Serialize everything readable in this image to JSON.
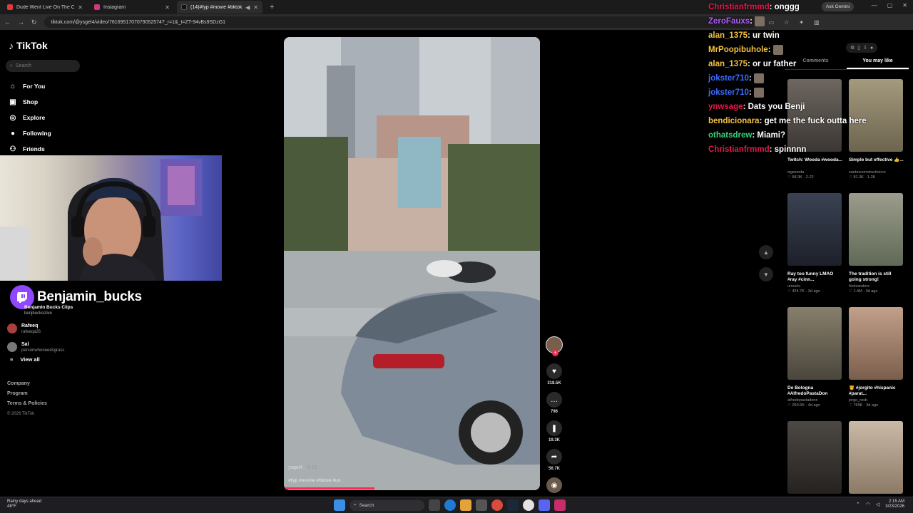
{
  "browser": {
    "tabs": [
      {
        "label": "Dude Went Live On The Opps",
        "color": "#e03a3a"
      },
      {
        "label": "Instagram",
        "color": "#d4377c"
      },
      {
        "label": "(14)#fyp #movie #tiktok #",
        "color": "#222222"
      }
    ],
    "new_tab": "+",
    "url": "tiktok.com/@ysgel4/video/7616951707079052574?_r=1&_t=ZT-94vBs9SDzG1",
    "ask_gemini": "Ask Gemini"
  },
  "sidebar": {
    "logo": "TikTok",
    "search_placeholder": "Search",
    "nav": [
      {
        "label": "For You",
        "icon": "home-icon"
      },
      {
        "label": "Shop",
        "icon": "shop-icon"
      },
      {
        "label": "Explore",
        "icon": "compass-icon"
      },
      {
        "label": "Following",
        "icon": "user-icon"
      },
      {
        "label": "Friends",
        "icon": "friends-icon"
      }
    ],
    "accounts": [
      {
        "name": "Rafeeq",
        "handle": "rafeeqa26"
      },
      {
        "name": "Sal",
        "handle": "personwhoneedsgrass"
      }
    ],
    "view_all": "View all",
    "footer": [
      "Company",
      "Program",
      "Terms & Policies"
    ],
    "copyright": "© 2026 TikTok"
  },
  "streamer": {
    "name": "Benjamin_bucks",
    "clip_title": "Benjamin Bucks Clips",
    "clip_handle": "benjbucksclive"
  },
  "video": {
    "author": "ysgel4",
    "date": "3-13",
    "tags": "#fyp #movie #tiktok #us",
    "progress": 0.35,
    "likes": "318.5K",
    "comments": "796",
    "saves": "19.3K",
    "shares": "56.7K"
  },
  "chat": [
    {
      "user": "Christianfrmmd",
      "color": "#e6194b",
      "msg": "onggg"
    },
    {
      "user": "ZeroFauxs",
      "color": "#b05cff",
      "msg": "",
      "emote": true
    },
    {
      "user": "alan_1375",
      "color": "#f5c242",
      "msg": "ur twin"
    },
    {
      "user": "MrPoopibuhole",
      "color": "#f5c242",
      "msg": "",
      "emote": true
    },
    {
      "user": "alan_1375",
      "color": "#f5c242",
      "msg": "or ur father"
    },
    {
      "user": "jokster710",
      "color": "#3a6cff",
      "msg": "",
      "emote": true
    },
    {
      "user": "jokster710",
      "color": "#3a6cff",
      "msg": "",
      "emote": true
    },
    {
      "user": "ynwsage",
      "color": "#e6194b",
      "msg": "Dats you Benji"
    },
    {
      "user": "bendicionara",
      "color": "#f5c242",
      "msg": "get me the fuck outta here"
    },
    {
      "user": "othatsdrew",
      "color": "#3ad17a",
      "msg": "Miami?"
    },
    {
      "user": "Christianfrmmd",
      "color": "#e6194b",
      "msg": "spinnnn"
    }
  ],
  "right_panel": {
    "tabs": [
      "Comments",
      "You may like"
    ],
    "items": [
      {
        "title": "Twitch: Wooda #wooda...",
        "author": "wgwooda",
        "likes": "58.3K",
        "date": "2-22",
        "color": "#5d5753"
      },
      {
        "title": "Simple but effective 👍...",
        "author": "santosconstructionco",
        "likes": "81.3K",
        "date": "1-28",
        "color": "#8b8069"
      },
      {
        "title": "Ray too funny LMAO #ray #cinn...",
        "author": "urneels",
        "likes": "424.7K",
        "date": "3d ago",
        "color": "#2f3540"
      },
      {
        "title": "The tradition is still going strong!",
        "author": "fordsanders",
        "likes": "1.4M",
        "date": "3d ago",
        "color": "#8a8a7a"
      },
      {
        "title": "De Bologna #AlfredoPastaDon",
        "author": "alfredopastadonn",
        "likes": "250.5K",
        "date": "4d ago",
        "color": "#706a5a"
      },
      {
        "title": "🫅 #jorgito #hispanic #parat...",
        "author": "jorge_rosb",
        "likes": "769K",
        "date": "3d ago",
        "color": "#a88a74"
      },
      {
        "title": "",
        "author": "",
        "likes": "",
        "date": "",
        "color": "#3c3a38"
      },
      {
        "title": "",
        "author": "",
        "likes": "",
        "date": "",
        "color": "#b0a090"
      }
    ]
  },
  "taskbar": {
    "weather_line1": "Rainy days ahead",
    "weather_line2": "48°F",
    "search": "Search",
    "time": "2:15 AM",
    "date": "3/23/2026"
  }
}
